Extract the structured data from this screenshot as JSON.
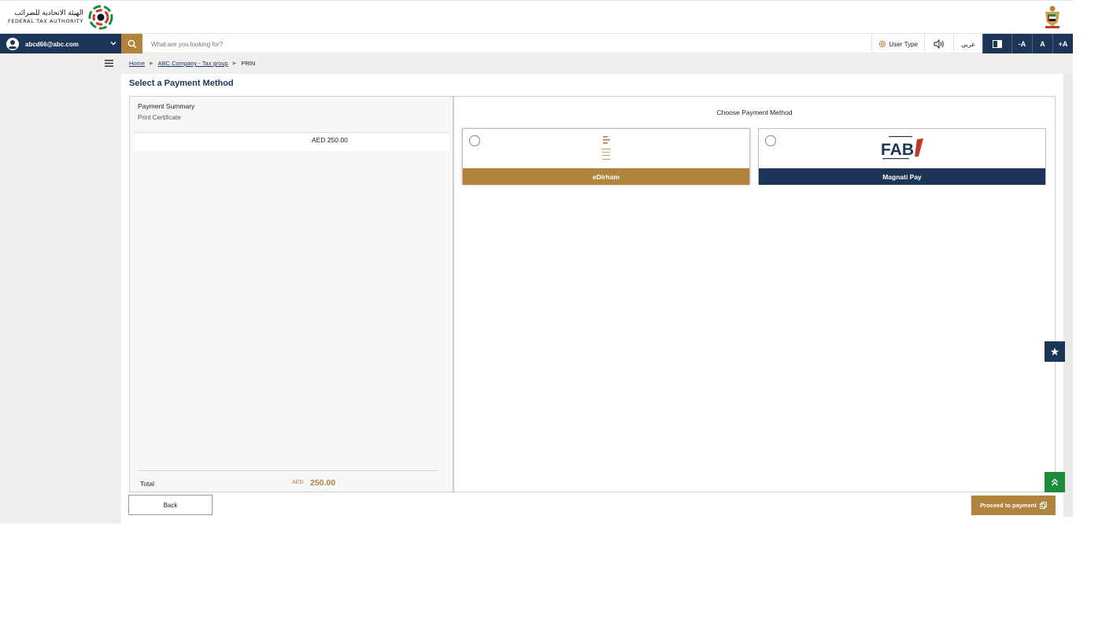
{
  "header": {
    "logo_ar": "الهيئة الاتحادية للضرائب",
    "logo_en": "FEDERAL TAX AUTHORITY",
    "logo_icon": "fta-logo",
    "emblem_icon": "uae-emblem"
  },
  "nav": {
    "user_email": "abcd66@abc.com",
    "search_placeholder": "What are you looking for?",
    "user_type": "User Type",
    "language": "عربي",
    "font_decrease": "-A",
    "font_normal": "A",
    "font_increase": "+A"
  },
  "breadcrumb": {
    "home": "Home",
    "company": "ABC Company - Tax group",
    "current": "PRIN"
  },
  "page": {
    "title": "Select a Payment Method"
  },
  "summary": {
    "title": "Payment Summary",
    "item": "Print Certificate",
    "item_amount": "AED 250.00",
    "total_label": "Total",
    "total_currency": "AED",
    "total_value": "250.00"
  },
  "methods": {
    "title": "Choose Payment Method",
    "options": [
      {
        "label": "eDirham",
        "selected": false
      },
      {
        "label": "Magnati Pay",
        "selected": false
      }
    ]
  },
  "actions": {
    "back": "Back",
    "proceed": "Proceed to payment"
  },
  "colors": {
    "navy": "#1d3557",
    "gold": "#b0843d",
    "green": "#1e8a3c"
  }
}
